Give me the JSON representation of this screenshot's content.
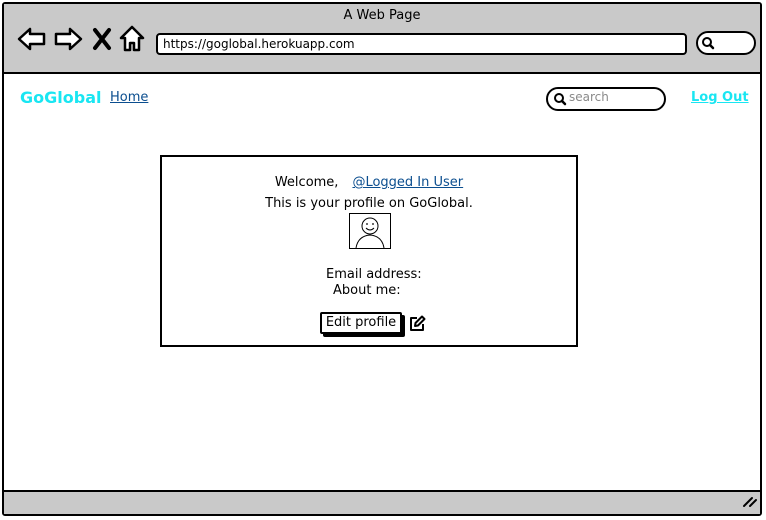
{
  "browser": {
    "title": "A Web Page",
    "url": "https://goglobal.herokuapp.com"
  },
  "site": {
    "brand": "GoGlobal",
    "brand_color": "#19e6f2",
    "link_color": "#0b4e8f",
    "nav": {
      "home": "Home",
      "search_placeholder": "search",
      "logout": "Log Out"
    }
  },
  "profile": {
    "welcome": "Welcome,",
    "user": "@Logged In User",
    "description": "This is your profile on GoGlobal.",
    "email_label": "Email address:",
    "about_label": "About me:",
    "edit_button": "Edit profile"
  },
  "icons": {
    "back": "arrow-left-icon",
    "forward": "arrow-right-icon",
    "stop": "close-icon",
    "home": "home-icon",
    "search": "search-icon",
    "avatar": "user-avatar-icon",
    "edit": "pencil-edit-icon",
    "resize": "resize-grip-icon"
  }
}
